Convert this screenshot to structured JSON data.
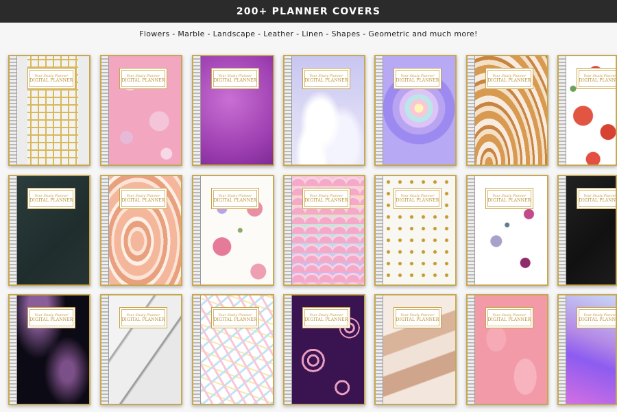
{
  "banner": {
    "title": "200+ PLANNER COVERS"
  },
  "subtitle": "Flowers - Marble - Landscape - Leather - Linen - Shapes - Geometric and much more!",
  "cover_label": {
    "script": "Your Study Planner",
    "title": "DIGITAL PLANNER"
  },
  "covers": [
    {
      "row": 1,
      "col": 1,
      "style": "Greek key gold on white"
    },
    {
      "row": 1,
      "col": 2,
      "style": "Pink paper flowers"
    },
    {
      "row": 1,
      "col": 3,
      "style": "Purple watercolor"
    },
    {
      "row": 1,
      "col": 4,
      "style": "Pastel clouds"
    },
    {
      "row": 1,
      "col": 5,
      "style": "Rainbow heart"
    },
    {
      "row": 1,
      "col": 6,
      "style": "Gold agate marble"
    },
    {
      "row": 1,
      "col": 7,
      "style": "Red roses"
    },
    {
      "row": 2,
      "col": 1,
      "style": "Dark green leather"
    },
    {
      "row": 2,
      "col": 2,
      "style": "Peach marble swirl"
    },
    {
      "row": 2,
      "col": 3,
      "style": "Pink peonies"
    },
    {
      "row": 2,
      "col": 4,
      "style": "Pastel scales"
    },
    {
      "row": 2,
      "col": 5,
      "style": "Gold hearts"
    },
    {
      "row": 2,
      "col": 6,
      "style": "Watercolor florals"
    },
    {
      "row": 2,
      "col": 7,
      "style": "Black leather"
    },
    {
      "row": 3,
      "col": 1,
      "style": "Galaxy glitter"
    },
    {
      "row": 3,
      "col": 2,
      "style": "White marble"
    },
    {
      "row": 3,
      "col": 3,
      "style": "Pastel feathers"
    },
    {
      "row": 3,
      "col": 4,
      "style": "Purple circles"
    },
    {
      "row": 3,
      "col": 5,
      "style": "Sand agate"
    },
    {
      "row": 3,
      "col": 6,
      "style": "Pink leaves"
    },
    {
      "row": 3,
      "col": 7,
      "style": "Holographic"
    }
  ],
  "colors": {
    "banner_bg": "#2b2b2b",
    "gold": "#c7a74f"
  }
}
